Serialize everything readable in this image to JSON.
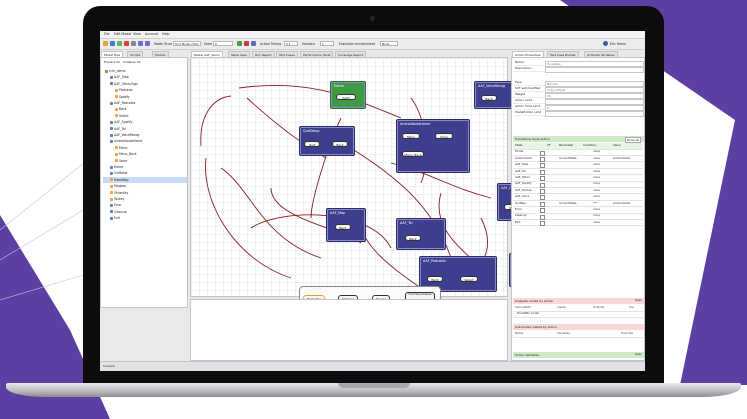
{
  "colors": {
    "background": "#ffffff",
    "purple_shape": "#5a3fa0",
    "node_blue": "#3e3e8e",
    "node_green": "#3f9a45",
    "link_red": "#8b1d1d",
    "highlight_orange": "#f09a2e",
    "section_green": "#cfe9c8",
    "section_pink": "#f7d7d7"
  },
  "menu": [
    "File",
    "Edit Model",
    "View",
    "Account",
    "Help"
  ],
  "toolbar": {
    "mode_label": "Mode: Error",
    "mode_value": "Tour Model (Tbd)",
    "seed_label": "Seed",
    "seed_value": "0",
    "steps_label": "Action Timing",
    "steps_value": "0 1",
    "versions_label": "Versions",
    "versions_value": "1",
    "env_label": "Execution environment",
    "env_value": "None",
    "user": "Eric Horne"
  },
  "left_panel": {
    "tabs": [
      "Model Tree",
      "Scripts",
      "Models"
    ],
    "buttons": [
      "Expand All",
      "Collapse All"
    ],
    "tree": [
      "rchr_demo",
      "AAF_Step",
      "AAF_Other/App",
      "Podcasts",
      "Spotify",
      "AAF_Podcasts",
      "Back",
      "Select",
      "AAF_Spotify",
      "AAF_Tel",
      "AAF_VoiceRecog",
      "AndroidAutoHome",
      "Menu",
      "Menu_Back",
      "Voice",
      "Home",
      "Surfbeat",
      "HomeKey",
      "Mapbox",
      "OtherKey",
      "Taskey",
      "Error",
      "Cleanup",
      "Exit"
    ]
  },
  "center": {
    "tabs": [
      "Model AAF_demo",
      "Table View",
      "Run Report",
      "Test Cases",
      "Performance Tests",
      "Coverage Report"
    ],
    "nodes": {
      "home": {
        "title": "Home",
        "states": [
          "Auth"
        ]
      },
      "voice_recog": {
        "title": "AAF_VoiceRecog",
        "states": [
          "Back"
        ]
      },
      "quit_setup": {
        "title": "QuitSetup",
        "states": [
          "Quit",
          "Back"
        ]
      },
      "android_auto_home": {
        "title": "AndroidAutoHome",
        "states": [
          "Menu",
          "Voice",
          "Menu_Back"
        ]
      },
      "other_app": {
        "title": "AAF_OtherApp",
        "states": [
          "Podcasts",
          "Spotify"
        ]
      },
      "aaf_map": {
        "title": "AAF_Map",
        "states": [
          "Back"
        ]
      },
      "aaf_tel": {
        "title": "AAF_Tel",
        "states": [
          "Back"
        ]
      },
      "aaf_podcasts": {
        "title": "AAF_Podcasts",
        "states": [
          "Back",
          "Select"
        ]
      },
      "aaf_spotify": {
        "title": "AAF_Spotify",
        "states": [
          "Back",
          "Select"
        ]
      },
      "bottom_group": [
        "HomeKey",
        "Mapbox",
        "Taskey",
        "DoorHelp Release"
      ]
    },
    "console_tab": "Console"
  },
  "right_panel": {
    "tabs": [
      "Action Properties",
      "Test Case Builder",
      "AI Model Variables"
    ],
    "props": [
      {
        "k": "Name",
        "v": "HomeKey"
      },
      {
        "k": "Description",
        "v": ""
      },
      {
        "k": "Type",
        "v": "Normal"
      },
      {
        "k": "SUT self-modified",
        "v": "Copy default"
      },
      {
        "k": "Weight",
        "v": "20"
      },
      {
        "k": "Action Limit",
        "v": ""
      },
      {
        "k": "Action Time Limit",
        "v": "0"
      },
      {
        "k": "Predefinition Limit",
        "v": ""
      }
    ],
    "transitions_header": "Transitions To/At Action",
    "transitions_filter": "show all",
    "grid_head": [
      "State",
      "",
      "VF",
      "Parameter",
      "Condition",
      "Value"
    ],
    "grid_rows": [
      {
        "state": "Home",
        "cond": "",
        "val": "none",
        "vf": ""
      },
      {
        "state": "AndroidAuto",
        "cond": "currentState",
        "val": "none",
        "vf": "AndroidAuto"
      },
      {
        "state": "AAF_Step",
        "cond": "",
        "val": "none",
        "vf": ""
      },
      {
        "state": "AAF_Tel",
        "cond": "",
        "val": "none",
        "vf": ""
      },
      {
        "state": "AAF_Other",
        "cond": "",
        "val": "none",
        "vf": ""
      },
      {
        "state": "AAF_Spotify",
        "cond": "",
        "val": "none",
        "vf": ""
      },
      {
        "state": "AAF_Podcas",
        "cond": "",
        "val": "none",
        "vf": ""
      },
      {
        "state": "AAF_Voice",
        "cond": "",
        "val": "none",
        "vf": ""
      },
      {
        "state": "QuitKey",
        "cond": "currentState",
        "val": "***",
        "vf": "AndroidAuto"
      },
      {
        "state": "Error",
        "cond": "",
        "val": "none",
        "vf": ""
      },
      {
        "state": "Cleanup",
        "cond": "",
        "val": "none",
        "vf": ""
      },
      {
        "state": "Exit",
        "cond": "",
        "val": "none",
        "vf": ""
      }
    ],
    "snippets_header": "Snippets Called by Action",
    "snippets_cols": [
      "SourcePath",
      "Inputs",
      "Outputs",
      "Sou"
    ],
    "snippets_row": "HomeBtn script",
    "variables_header": "Submodels Called by Action",
    "variables_cols": [
      "Name",
      "Variables",
      "Override"
    ],
    "action_vars": "Action Variables",
    "open_label": "Open"
  }
}
